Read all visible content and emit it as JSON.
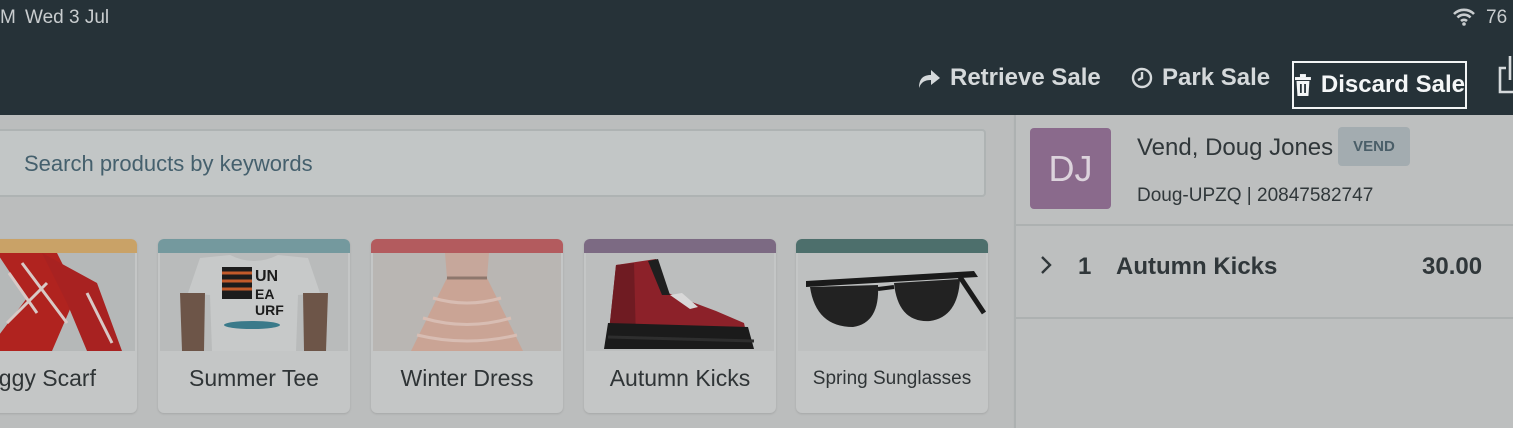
{
  "status_bar": {
    "time": "M",
    "date": "Wed 3 Jul",
    "battery": "76"
  },
  "header": {
    "retrieve_label": "Retrieve Sale",
    "park_label": "Park Sale",
    "discard_label": "Discard Sale"
  },
  "search": {
    "placeholder": "Search products by keywords"
  },
  "products": [
    {
      "name": "aggy Scarf",
      "color": "#c9a267"
    },
    {
      "name": "Summer Tee",
      "color": "#74999e"
    },
    {
      "name": "Winter Dress",
      "color": "#b35b5e"
    },
    {
      "name": "Autumn Kicks",
      "color": "#7c6a83"
    },
    {
      "name": "Spring Sunglasses",
      "color": "#4d6f6c"
    }
  ],
  "customer": {
    "initials": "DJ",
    "name": "Vend, Doug Jones",
    "badge": "VEND",
    "sub": "Doug-UPZQ | 20847582747",
    "avatar_color": "#8a6a8c"
  },
  "sale": {
    "items": [
      {
        "qty": "1",
        "name": "Autumn Kicks",
        "price": "30.00"
      }
    ]
  },
  "colors": {
    "header_bg": "#263238",
    "accent": "#8a6a8c"
  }
}
